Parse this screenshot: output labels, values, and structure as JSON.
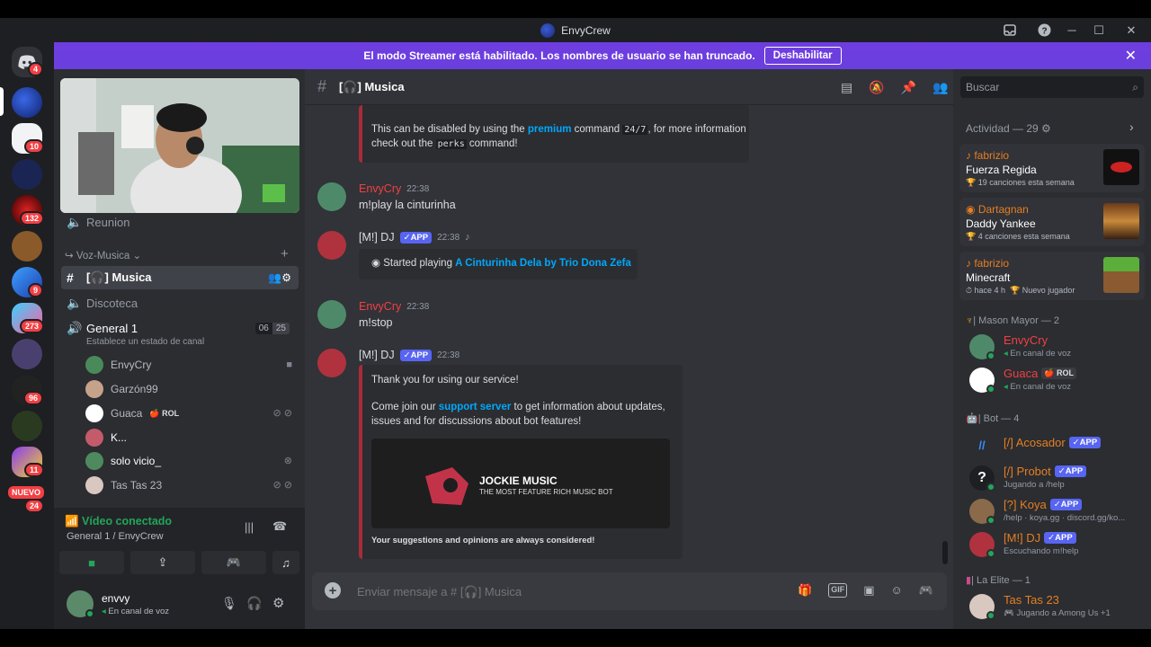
{
  "window": {
    "title": "EnvyCrew"
  },
  "banner": {
    "text": "El modo Streamer está habilitado. Los nombres de usuario se han truncado.",
    "button": "Deshabilitar"
  },
  "rail": {
    "badges": [
      "4",
      "10",
      "132",
      "9",
      "273",
      "96",
      "11",
      "NUEVO",
      "24"
    ]
  },
  "sidebar": {
    "reunion": "Reunion",
    "category": "Voz-Musica",
    "musica": "[🎧] Musica",
    "discoteca": "Discoteca",
    "general": "General 1",
    "general_status": "Establece un estado de canal",
    "general_counts": [
      "06",
      "25"
    ],
    "voice_users": [
      "EnvyCry",
      "Garzón99",
      "Guaca",
      "K...",
      "solo vicio_",
      "Tas Tas 23"
    ],
    "rol_badge": "ROL"
  },
  "voice_panel": {
    "status": "Vídeo conectado",
    "location": "General 1 / EnvyCrew"
  },
  "user": {
    "name": "envvy",
    "status": "En canal de voz"
  },
  "channel": {
    "name": "[🎧] Musica"
  },
  "messages": {
    "embed1_line1_pre": "This can be disabled by using the ",
    "embed1_link": "premium",
    "embed1_mid": " command ",
    "embed1_code1": "24/7",
    "embed1_post": ", for more information",
    "embed1_line2_pre": "check out the ",
    "embed1_code2": "perks",
    "embed1_line2_post": " command!",
    "m1_author": "EnvyCry",
    "m1_time": "22:38",
    "m1_text": "m!play la cinturinha",
    "m2_author": "[M!] DJ",
    "m2_app": "APP",
    "m2_time": "22:38",
    "m2_embed_pre": "Started playing ",
    "m2_embed_link": "A Cinturinha Dela by Trio Dona Zefa",
    "m3_author": "EnvyCry",
    "m3_time": "22:38",
    "m3_text": "m!stop",
    "m4_author": "[M!] DJ",
    "m4_app": "APP",
    "m4_time": "22:38",
    "m4_p1": "Thank you for using our service!",
    "m4_p2_pre": "Come join our ",
    "m4_p2_link": "support server",
    "m4_p2_post": " to get information about updates,",
    "m4_p2_line2": "issues and for discussions about bot features!",
    "m4_img_title": "JOCKIE MUSIC",
    "m4_img_sub": "THE MOST FEATURE RICH MUSIC BOT",
    "m4_footer": "Your suggestions and opinions are always considered!"
  },
  "composer": {
    "placeholder": "Enviar mensaje a # [🎧] Musica"
  },
  "right": {
    "search": "Buscar",
    "activity_header": "Actividad — 29",
    "activities": [
      {
        "user": "fabrizio",
        "title": "Fuerza Regida",
        "sub": "19 canciones esta semana"
      },
      {
        "user": "Dartagnan",
        "title": "Daddy Yankee",
        "sub": "4 canciones esta semana"
      },
      {
        "user": "fabrizio",
        "title": "Minecraft",
        "sub": "hace 4 h",
        "sub2": "Nuevo jugador"
      }
    ],
    "mason_header": "| Mason Mayor — 2",
    "mason": [
      {
        "name": "EnvyCry",
        "sub": "En canal de voz"
      },
      {
        "name": "Guaca",
        "badge": "ROL",
        "sub": "En canal de voz"
      }
    ],
    "bot_header": "| Bot — 4",
    "bots": [
      {
        "name": "[/] Acosador",
        "sub": ""
      },
      {
        "name": "[/] Probot",
        "sub": "Jugando a /help"
      },
      {
        "name": "[?] Koya",
        "sub": "/help · koya.gg · discord.gg/ko..."
      },
      {
        "name": "[M!] DJ",
        "sub": "Escuchando m!help"
      }
    ],
    "app_badge": "APP",
    "elite_header": "| La Elite — 1",
    "elite": [
      {
        "name": "Tas Tas 23",
        "sub": "Jugando a Among Us +1"
      }
    ]
  },
  "colors": {
    "accent": "#5865f2",
    "banner": "#6b3fdf",
    "red_name": "#f23f43",
    "orange_name": "#e67e22",
    "green": "#23a55a"
  }
}
